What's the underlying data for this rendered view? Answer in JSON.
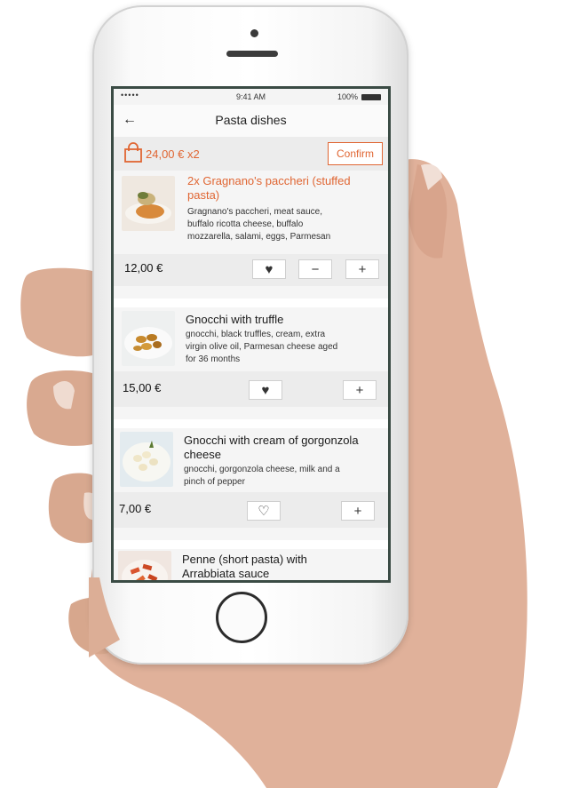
{
  "status": {
    "signal": "•••••",
    "time": "9:41 AM",
    "battery": "100%"
  },
  "nav": {
    "back": "←",
    "title": "Pasta dishes"
  },
  "cart": {
    "total": "24,00 € x2",
    "confirm_label": "Confirm"
  },
  "items": [
    {
      "name_line1": "2x Gragnano's paccheri (stuffed",
      "name_line2": "pasta)",
      "desc_line1": "Gragnano's paccheri, meat sauce,",
      "desc_line2": "buffalo ricotta cheese, buffalo",
      "desc_line3": "mozzarella, salami, eggs, Parmesan",
      "price": "12,00 €"
    },
    {
      "name_line1": "Gnocchi with truffle",
      "desc_line1": "gnocchi, black truffles, cream, extra",
      "desc_line2": "virgin olive oil, Parmesan cheese aged",
      "desc_line3": "for 36 months",
      "price": "15,00 €"
    },
    {
      "name_line1": "Gnocchi with cream of gorgonzola",
      "name_line2": "cheese",
      "desc_line1": "gnocchi, gorgonzola cheese, milk and a",
      "desc_line2": "pinch of pepper",
      "price": "7,00 €"
    },
    {
      "name_line1": "Penne (short pasta) with",
      "name_line2": "Arrabbiata sauce"
    }
  ],
  "buttons": {
    "minus": "−",
    "plus": "+"
  },
  "colors": {
    "accent": "#e06633",
    "frame": "#3a4b44"
  }
}
